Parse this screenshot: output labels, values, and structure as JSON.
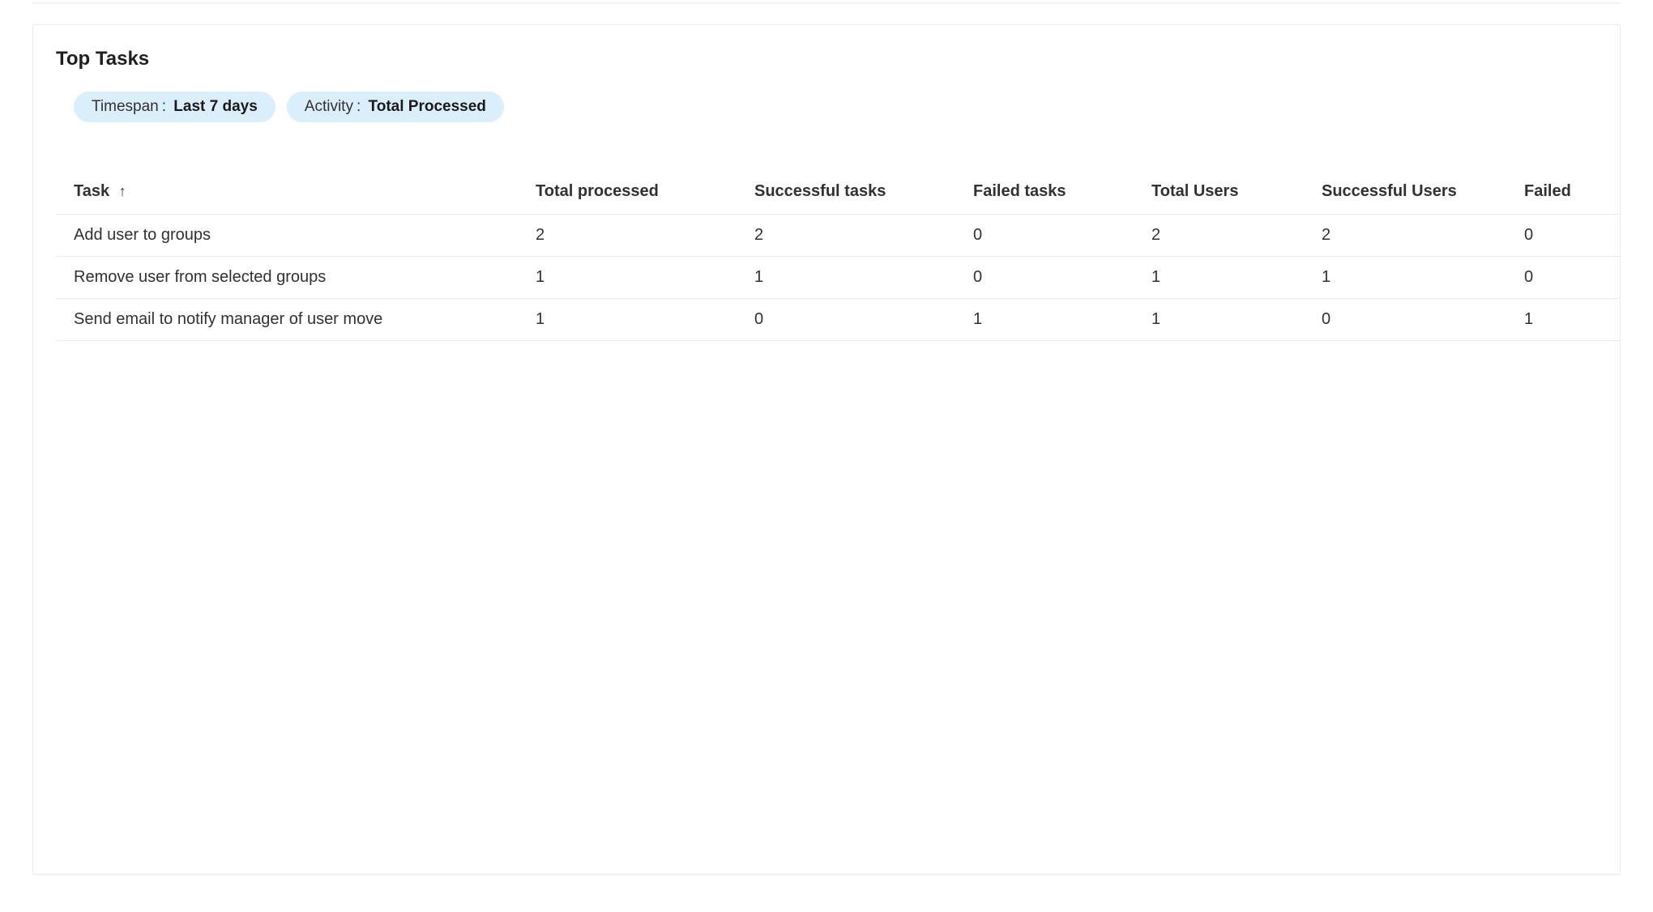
{
  "card": {
    "title": "Top Tasks"
  },
  "filters": {
    "timespan": {
      "label": "Timespan",
      "sep": ":",
      "value": "Last 7 days"
    },
    "activity": {
      "label": "Activity",
      "sep": ":",
      "value": "Total Processed"
    }
  },
  "table": {
    "columns": [
      {
        "label": "Task",
        "sorted": true
      },
      {
        "label": "Total processed"
      },
      {
        "label": "Successful tasks"
      },
      {
        "label": "Failed tasks"
      },
      {
        "label": "Total Users"
      },
      {
        "label": "Successful Users"
      },
      {
        "label": "Failed"
      }
    ],
    "sort_arrow": "↑",
    "rows": [
      {
        "task": "Add user to groups",
        "total_processed": "2",
        "successful_tasks": "2",
        "failed_tasks": "0",
        "total_users": "2",
        "successful_users": "2",
        "failed": "0"
      },
      {
        "task": "Remove user from selected groups",
        "total_processed": "1",
        "successful_tasks": "1",
        "failed_tasks": "0",
        "total_users": "1",
        "successful_users": "1",
        "failed": "0"
      },
      {
        "task": "Send email to notify manager of user move",
        "total_processed": "1",
        "successful_tasks": "0",
        "failed_tasks": "1",
        "total_users": "1",
        "successful_users": "0",
        "failed": "1"
      }
    ]
  }
}
